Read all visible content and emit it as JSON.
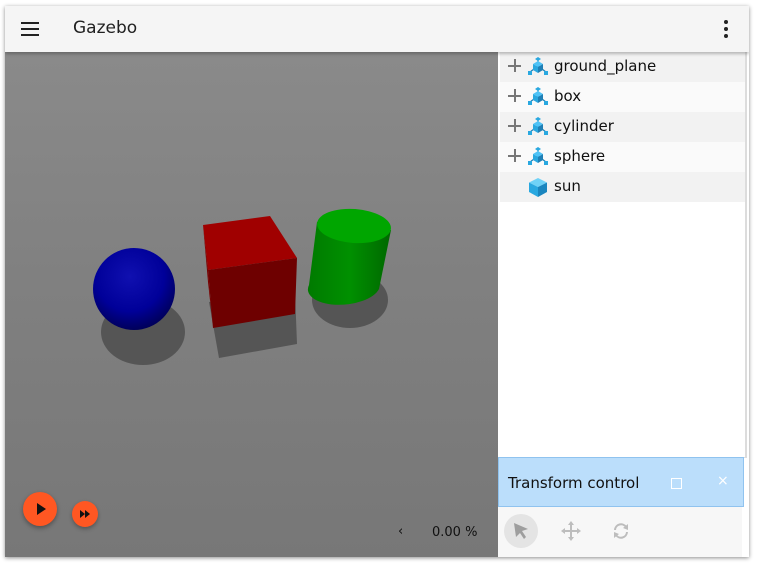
{
  "window": {
    "title": "Gazebo"
  },
  "titlebar": {
    "menu_icon": "hamburger-menu-icon",
    "more_icon": "more-vert-icon"
  },
  "playback": {
    "play_icon": "play-icon",
    "step_icon": "fast-forward-icon",
    "rtf_chevron": "‹",
    "rtf_value": "0.00 %"
  },
  "scene": {
    "objects": [
      {
        "name": "sphere",
        "color": "#00008b"
      },
      {
        "name": "box",
        "color": "#8b0000"
      },
      {
        "name": "cylinder",
        "color": "#008b00"
      }
    ]
  },
  "entity_tree": {
    "items": [
      {
        "label": "ground_plane",
        "icon": "model-icon",
        "expandable": true
      },
      {
        "label": "box",
        "icon": "model-icon",
        "expandable": true
      },
      {
        "label": "cylinder",
        "icon": "model-icon",
        "expandable": true
      },
      {
        "label": "sphere",
        "icon": "model-icon",
        "expandable": true
      },
      {
        "label": "sun",
        "icon": "light-icon",
        "expandable": false
      }
    ]
  },
  "transform_control": {
    "title": "Transform control",
    "close_label": "×",
    "tools": [
      "select-icon",
      "translate-icon",
      "rotate-icon"
    ],
    "selected_tool": "select-icon"
  },
  "colors": {
    "accent": "#ff5722",
    "panel_header": "#bbdefb",
    "icon_blue": "#29a8e0"
  }
}
